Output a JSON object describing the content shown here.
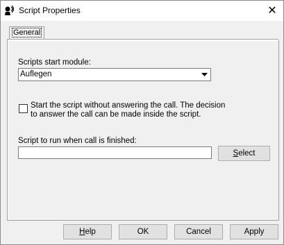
{
  "window": {
    "title": "Script Properties",
    "close_glyph": "✕"
  },
  "tabs": [
    {
      "label": "General",
      "selected": true
    }
  ],
  "general": {
    "start_module_label": "Scripts start module:",
    "start_module_value": "Auflegen",
    "dropdown_icon": "dropdown-arrow-icon",
    "checkbox_line1": "Start the script without answering the call. The decision",
    "checkbox_line2": "to answer the call can be made inside the script.",
    "checkbox_checked": false,
    "finish_script_label": "Script to run when call is finished:",
    "finish_script_value": "",
    "select_button_first": "S",
    "select_button_rest": "elect"
  },
  "buttons": {
    "help_first": "H",
    "help_rest": "elp",
    "ok": "OK",
    "cancel": "Cancel",
    "apply": "Apply"
  },
  "colors": {
    "window_bg": "#f0f0f0",
    "titlebar_bg": "#ffffff",
    "button_bg": "#e1e1e1",
    "border": "#a0a0a0"
  }
}
